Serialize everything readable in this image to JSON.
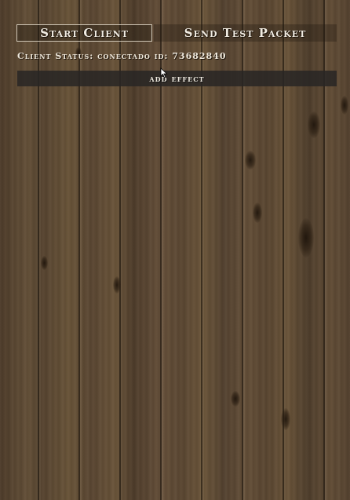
{
  "toolbar": {
    "start_client_label": "Start Client",
    "send_test_packet_label": "Send Test Packet"
  },
  "status": {
    "text": "Client Status: conectado id: 73682840"
  },
  "add_effect_label": "add effect",
  "icons": {
    "cursor": "mouse-pointer-icon"
  }
}
